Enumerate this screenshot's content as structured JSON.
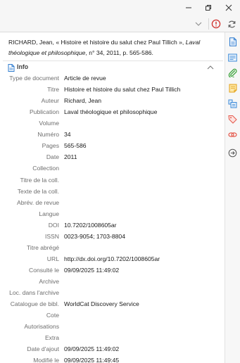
{
  "citation": {
    "authors_prefix": "RICHARD, Jean, « Histoire et histoire du salut chez Paul Tillich », ",
    "journal_italic": "Laval théologique et philosophique",
    "rest": ", n° 34, 2011, p. 565-586."
  },
  "section": {
    "title": "Info"
  },
  "fields": [
    {
      "label": "Type de document",
      "value": "Article de revue"
    },
    {
      "label": "Titre",
      "value": "Histoire et histoire du salut chez Paul Tillich"
    },
    {
      "label": "Auteur",
      "value": "Richard, Jean"
    },
    {
      "label": "Publication",
      "value": "Laval théologique et philosophique"
    },
    {
      "label": "Volume",
      "value": ""
    },
    {
      "label": "Numéro",
      "value": "34"
    },
    {
      "label": "Pages",
      "value": "565-586"
    },
    {
      "label": "Date",
      "value": "2011"
    },
    {
      "label": "Collection",
      "value": ""
    },
    {
      "label": "Titre de la coll.",
      "value": ""
    },
    {
      "label": "Texte de la coll.",
      "value": ""
    },
    {
      "label": "Abrév. de revue",
      "value": ""
    },
    {
      "label": "Langue",
      "value": ""
    },
    {
      "label": "DOI",
      "value": "10.7202/1008605ar"
    },
    {
      "label": "ISSN",
      "value": "0023-9054; 1703-8804"
    },
    {
      "label": "Titre abrégé",
      "value": ""
    },
    {
      "label": "URL",
      "value": "http://dx.doi.org/10.7202/1008605ar"
    },
    {
      "label": "Consulté le",
      "value": "09/09/2025 11:49:02"
    },
    {
      "label": "Archive",
      "value": ""
    },
    {
      "label": "Loc. dans l'archive",
      "value": ""
    },
    {
      "label": "Catalogue de bibl.",
      "value": "WorldCat Discovery Service"
    },
    {
      "label": "Cote",
      "value": ""
    },
    {
      "label": "Autorisations",
      "value": ""
    },
    {
      "label": "Extra",
      "value": ""
    },
    {
      "label": "Date d'ajout",
      "value": "09/09/2025 11:49:02"
    },
    {
      "label": "Modifié le",
      "value": "09/09/2025 11:49:45"
    }
  ],
  "sidenav": {
    "icons": [
      "info-icon",
      "abstract-icon",
      "attachments-icon",
      "notes-icon",
      "libraries-collections-icon",
      "tags-icon",
      "related-icon",
      "locate-icon"
    ]
  },
  "colors": {
    "accent": "#2e7bcf",
    "alert": "#d0312d"
  }
}
